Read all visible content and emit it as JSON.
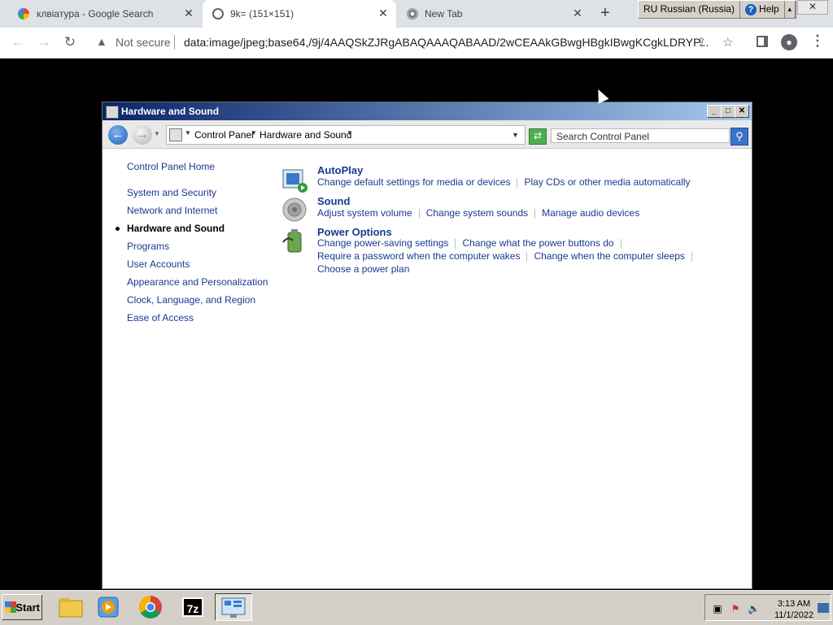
{
  "browser": {
    "tabs": [
      {
        "label": "клвіатура - Google Search",
        "icon": "google-icon"
      },
      {
        "label": "9k= (151×151)",
        "icon": "globe-icon"
      },
      {
        "label": "New Tab",
        "icon": "chrome-icon"
      }
    ],
    "address": {
      "security_label": "Not secure",
      "url": "data:image/jpeg;base64,/9j/4AAQSkZJRgABAQAAAQABAAD/2wCEAAkGBwgHBgkIBwgKCgkLDRYP..."
    },
    "language_bar": {
      "language": "RU Russian (Russia)",
      "help": "Help"
    }
  },
  "window": {
    "title": "Hardware and Sound",
    "breadcrumbs": [
      "Control Panel",
      "Hardware and Sound"
    ],
    "search_placeholder": "Search Control Panel",
    "nav": {
      "home": "Control Panel Home",
      "items": [
        "System and Security",
        "Network and Internet",
        "Hardware and Sound",
        "Programs",
        "User Accounts",
        "Appearance and Personalization",
        "Clock, Language, and Region",
        "Ease of Access"
      ],
      "current": "Hardware and Sound"
    },
    "categories": [
      {
        "title": "AutoPlay",
        "icon": "autoplay-icon",
        "links": [
          [
            "Change default settings for media or devices",
            "Play CDs or other media automatically"
          ]
        ]
      },
      {
        "title": "Sound",
        "icon": "speaker-icon",
        "links": [
          [
            "Adjust system volume",
            "Change system sounds",
            "Manage audio devices"
          ]
        ]
      },
      {
        "title": "Power Options",
        "icon": "battery-icon",
        "links": [
          [
            "Change power-saving settings",
            "Change what the power buttons do"
          ],
          [
            "Require a password when the computer wakes",
            "Change when the computer sleeps"
          ],
          [
            "Choose a power plan"
          ]
        ]
      }
    ]
  },
  "taskbar": {
    "start_label": "Start",
    "clock_time": "3:13 AM",
    "clock_date": "11/1/2022",
    "apps": [
      "file-explorer-icon",
      "media-player-icon",
      "chrome-icon",
      "7zip-icon",
      "control-panel-icon"
    ],
    "sevenzip_label": "7z"
  }
}
